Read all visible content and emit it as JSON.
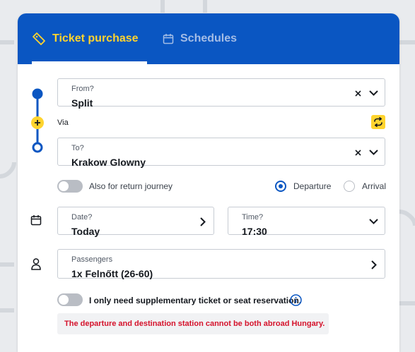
{
  "tabs": {
    "ticket_purchase": "Ticket purchase",
    "schedules": "Schedules"
  },
  "from": {
    "label": "From?",
    "value": "Split"
  },
  "via": {
    "label": "Via"
  },
  "to": {
    "label": "To?",
    "value": "Krakow Glowny"
  },
  "return_journey": {
    "label": "Also for return journey",
    "enabled": false
  },
  "time_mode": {
    "options": [
      "Departure",
      "Arrival"
    ],
    "selected": "Departure"
  },
  "date": {
    "label": "Date?",
    "value": "Today"
  },
  "time": {
    "label": "Time?",
    "value": "17:30"
  },
  "passengers": {
    "label": "Passengers",
    "value": "1x Felnőtt (26-60)"
  },
  "supplementary": {
    "label": "I only need supplementary ticket or seat reservation.",
    "enabled": false
  },
  "error": {
    "message": "The departure and destination station cannot be both abroad Hungary."
  },
  "colors": {
    "brand_blue": "#0a56c2",
    "accent_yellow": "#ffd42e",
    "error_red": "#d5122b"
  },
  "icons": {
    "ticket_tab": "ticket-icon",
    "schedules_tab": "calendar-icon",
    "clear": "close-icon",
    "dropdown": "chevron-down-icon",
    "next": "chevron-right-icon",
    "swap": "swap-icon",
    "add_via": "plus-icon",
    "date": "calendar-icon",
    "passengers": "person-icon",
    "info": "info-icon"
  }
}
